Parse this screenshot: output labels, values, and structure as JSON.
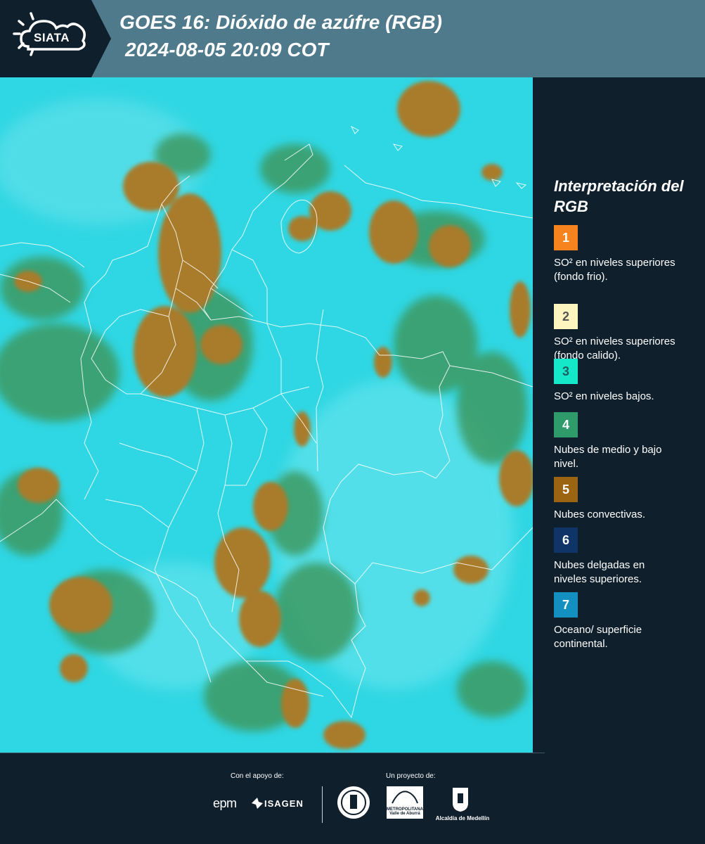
{
  "header": {
    "logo_text": "SIATA",
    "title_line1": "GOES 16: Dióxido de azúfre (RGB)",
    "title_line2": "2024-08-05 20:09 COT"
  },
  "colors": {
    "header_bg": "#4e7a8c",
    "page_bg": "#0f1f2c",
    "ocean": "#2fd6e3",
    "convective": "#a87c2a",
    "mid_low": "#3e9a62",
    "border_line": "#ffffff"
  },
  "legend": {
    "title": "Interpretación del RGB",
    "items": [
      {
        "number": "1",
        "color": "#f6831e",
        "number_color": "#ffffff",
        "label": "SO² en niveles superiores (fondo frio)."
      },
      {
        "number": "2",
        "color": "#fdf5c0",
        "number_color": "#555555",
        "label": "SO² en niveles superiores (fondo calido)."
      },
      {
        "number": "3",
        "color": "#15e8c8",
        "number_color": "#1f5f60",
        "label": "SO² en niveles bajos."
      },
      {
        "number": "4",
        "color": "#2f9a6a",
        "number_color": "#ffffff",
        "label": "Nubes de medio y bajo nivel."
      },
      {
        "number": "5",
        "color": "#9b6413",
        "number_color": "#ffffff",
        "label": "Nubes convectivas."
      },
      {
        "number": "6",
        "color": "#0e3468",
        "number_color": "#ffffff",
        "label": "Nubes delgadas en niveles superiores."
      },
      {
        "number": "7",
        "color": "#1390c0",
        "number_color": "#ffffff",
        "label": "Oceano/ superficie continental."
      }
    ]
  },
  "footer": {
    "support_label": "Con el apoyo de:",
    "project_label": "Un proyecto de:",
    "sponsor1": "epm",
    "sponsor2": "ISAGEN",
    "partner_area": "METROPOLITANA Valle de Aburrá",
    "partner_alcaldia": "Alcaldía de Medellín"
  }
}
